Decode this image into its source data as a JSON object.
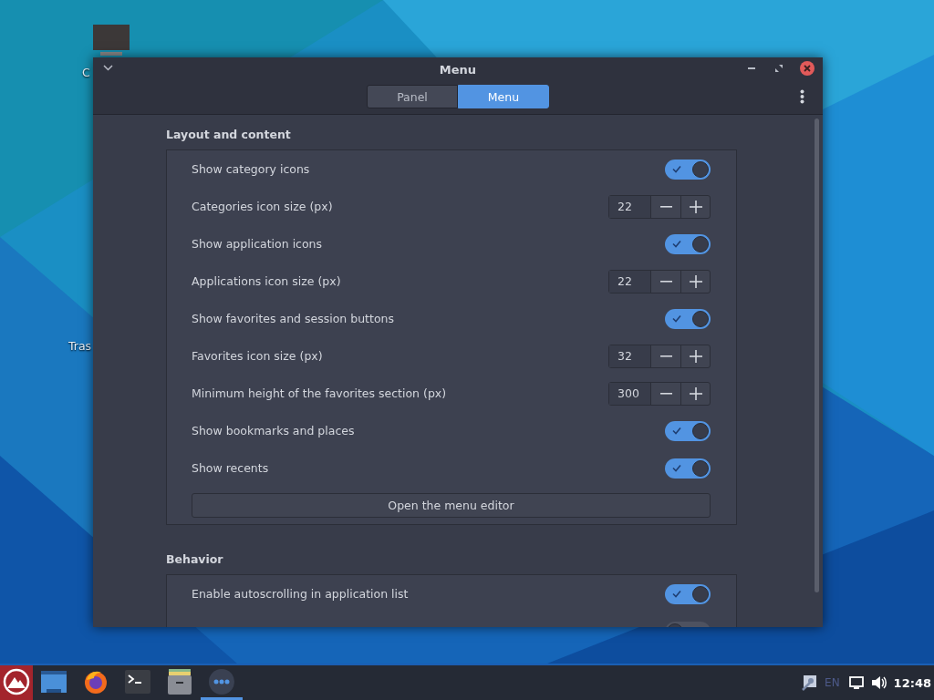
{
  "desktop": {
    "icons": [
      {
        "label": "C"
      },
      {
        "label": "Tras"
      }
    ]
  },
  "window": {
    "title": "Menu",
    "tabs": [
      {
        "label": "Panel",
        "selected": false
      },
      {
        "label": "Menu",
        "selected": true
      }
    ],
    "sections": [
      {
        "title": "Layout and content",
        "rows": [
          {
            "kind": "switch",
            "label": "Show category icons",
            "on": true
          },
          {
            "kind": "spin",
            "label": "Categories icon size (px)",
            "value": "22"
          },
          {
            "kind": "switch",
            "label": "Show application icons",
            "on": true
          },
          {
            "kind": "spin",
            "label": "Applications icon size (px)",
            "value": "22"
          },
          {
            "kind": "switch",
            "label": "Show favorites and session buttons",
            "on": true
          },
          {
            "kind": "spin",
            "label": "Favorites icon size (px)",
            "value": "32"
          },
          {
            "kind": "spin",
            "label": "Minimum height of the favorites section (px)",
            "value": "300"
          },
          {
            "kind": "switch",
            "label": "Show bookmarks and places",
            "on": true
          },
          {
            "kind": "switch",
            "label": "Show recents",
            "on": true
          },
          {
            "kind": "button",
            "label": "Open the menu editor"
          }
        ]
      },
      {
        "title": "Behavior",
        "rows": [
          {
            "kind": "switch",
            "label": "Enable autoscrolling in application list",
            "on": true
          },
          {
            "kind": "switch",
            "on": false
          }
        ]
      }
    ]
  },
  "taskbar": {
    "items": [
      {
        "active": false
      },
      {
        "active": false
      },
      {
        "active": false
      },
      {
        "active": false
      },
      {
        "active": false
      },
      {
        "active": true
      }
    ],
    "language": "EN",
    "clock": "12:48"
  }
}
